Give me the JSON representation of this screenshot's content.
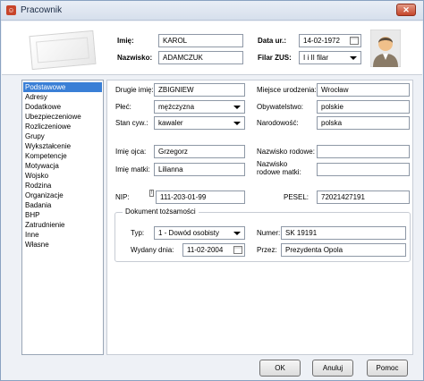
{
  "window": {
    "title": "Pracownik",
    "close_label": "✕"
  },
  "header": {
    "first_name_label": "Imię:",
    "first_name": "KAROL",
    "last_name_label": "Nazwisko:",
    "last_name": "ADAMCZUK",
    "birth_date_label": "Data ur.:",
    "birth_date": "14-02-1972",
    "zus_label": "Filar ZUS:",
    "zus_value": "I i II filar"
  },
  "sidebar": {
    "items": [
      "Podstawowe",
      "Adresy",
      "Dodatkowe",
      "Ubezpieczeniowe",
      "Rozliczeniowe",
      "Grupy",
      "Wykształcenie",
      "Kompetencje",
      "Motywacja",
      "Wojsko",
      "Rodzina",
      "Organizacje",
      "Badania",
      "BHP",
      "Zatrudnienie",
      "Inne",
      "Własne"
    ],
    "active_index": 0
  },
  "form": {
    "second_name_label": "Drugie imię:",
    "second_name": "ZBIGNIEW",
    "birth_place_label": "Miejsce urodzenia:",
    "birth_place": "Wrocław",
    "gender_label": "Płeć:",
    "gender": "mężczyzna",
    "citizenship_label": "Obywatelstwo:",
    "citizenship": "polskie",
    "civil_status_label": "Stan cyw.:",
    "civil_status": "kawaler",
    "nationality_label": "Narodowość:",
    "nationality": "polska",
    "father_label": "Imię ojca:",
    "father": "Grzegorz",
    "family_name_label": "Nazwisko rodowe:",
    "family_name": "",
    "mother_label": "Imię matki:",
    "mother": "Lilianna",
    "mother_family_label_1": "Nazwisko",
    "mother_family_label_2": "rodowe matki:",
    "mother_family": "",
    "nip_label": "NIP:",
    "nip": "111-203-01-99",
    "pesel_label": "PESEL:",
    "pesel": "72021427191"
  },
  "document": {
    "group_title": "Dokument tożsamości",
    "type_label": "Typ:",
    "type": "1 - Dowód osobisty",
    "number_label": "Numer:",
    "number": "SK 19191",
    "issued_label": "Wydany dnia:",
    "issued": "11-02-2004",
    "by_label": "Przez:",
    "by": "Prezydenta Opola"
  },
  "buttons": {
    "ok": "OK",
    "cancel": "Anuluj",
    "help": "Pomoc"
  },
  "colors": {
    "accent": "#3a7fd6",
    "title_icon": "#c8452b"
  }
}
